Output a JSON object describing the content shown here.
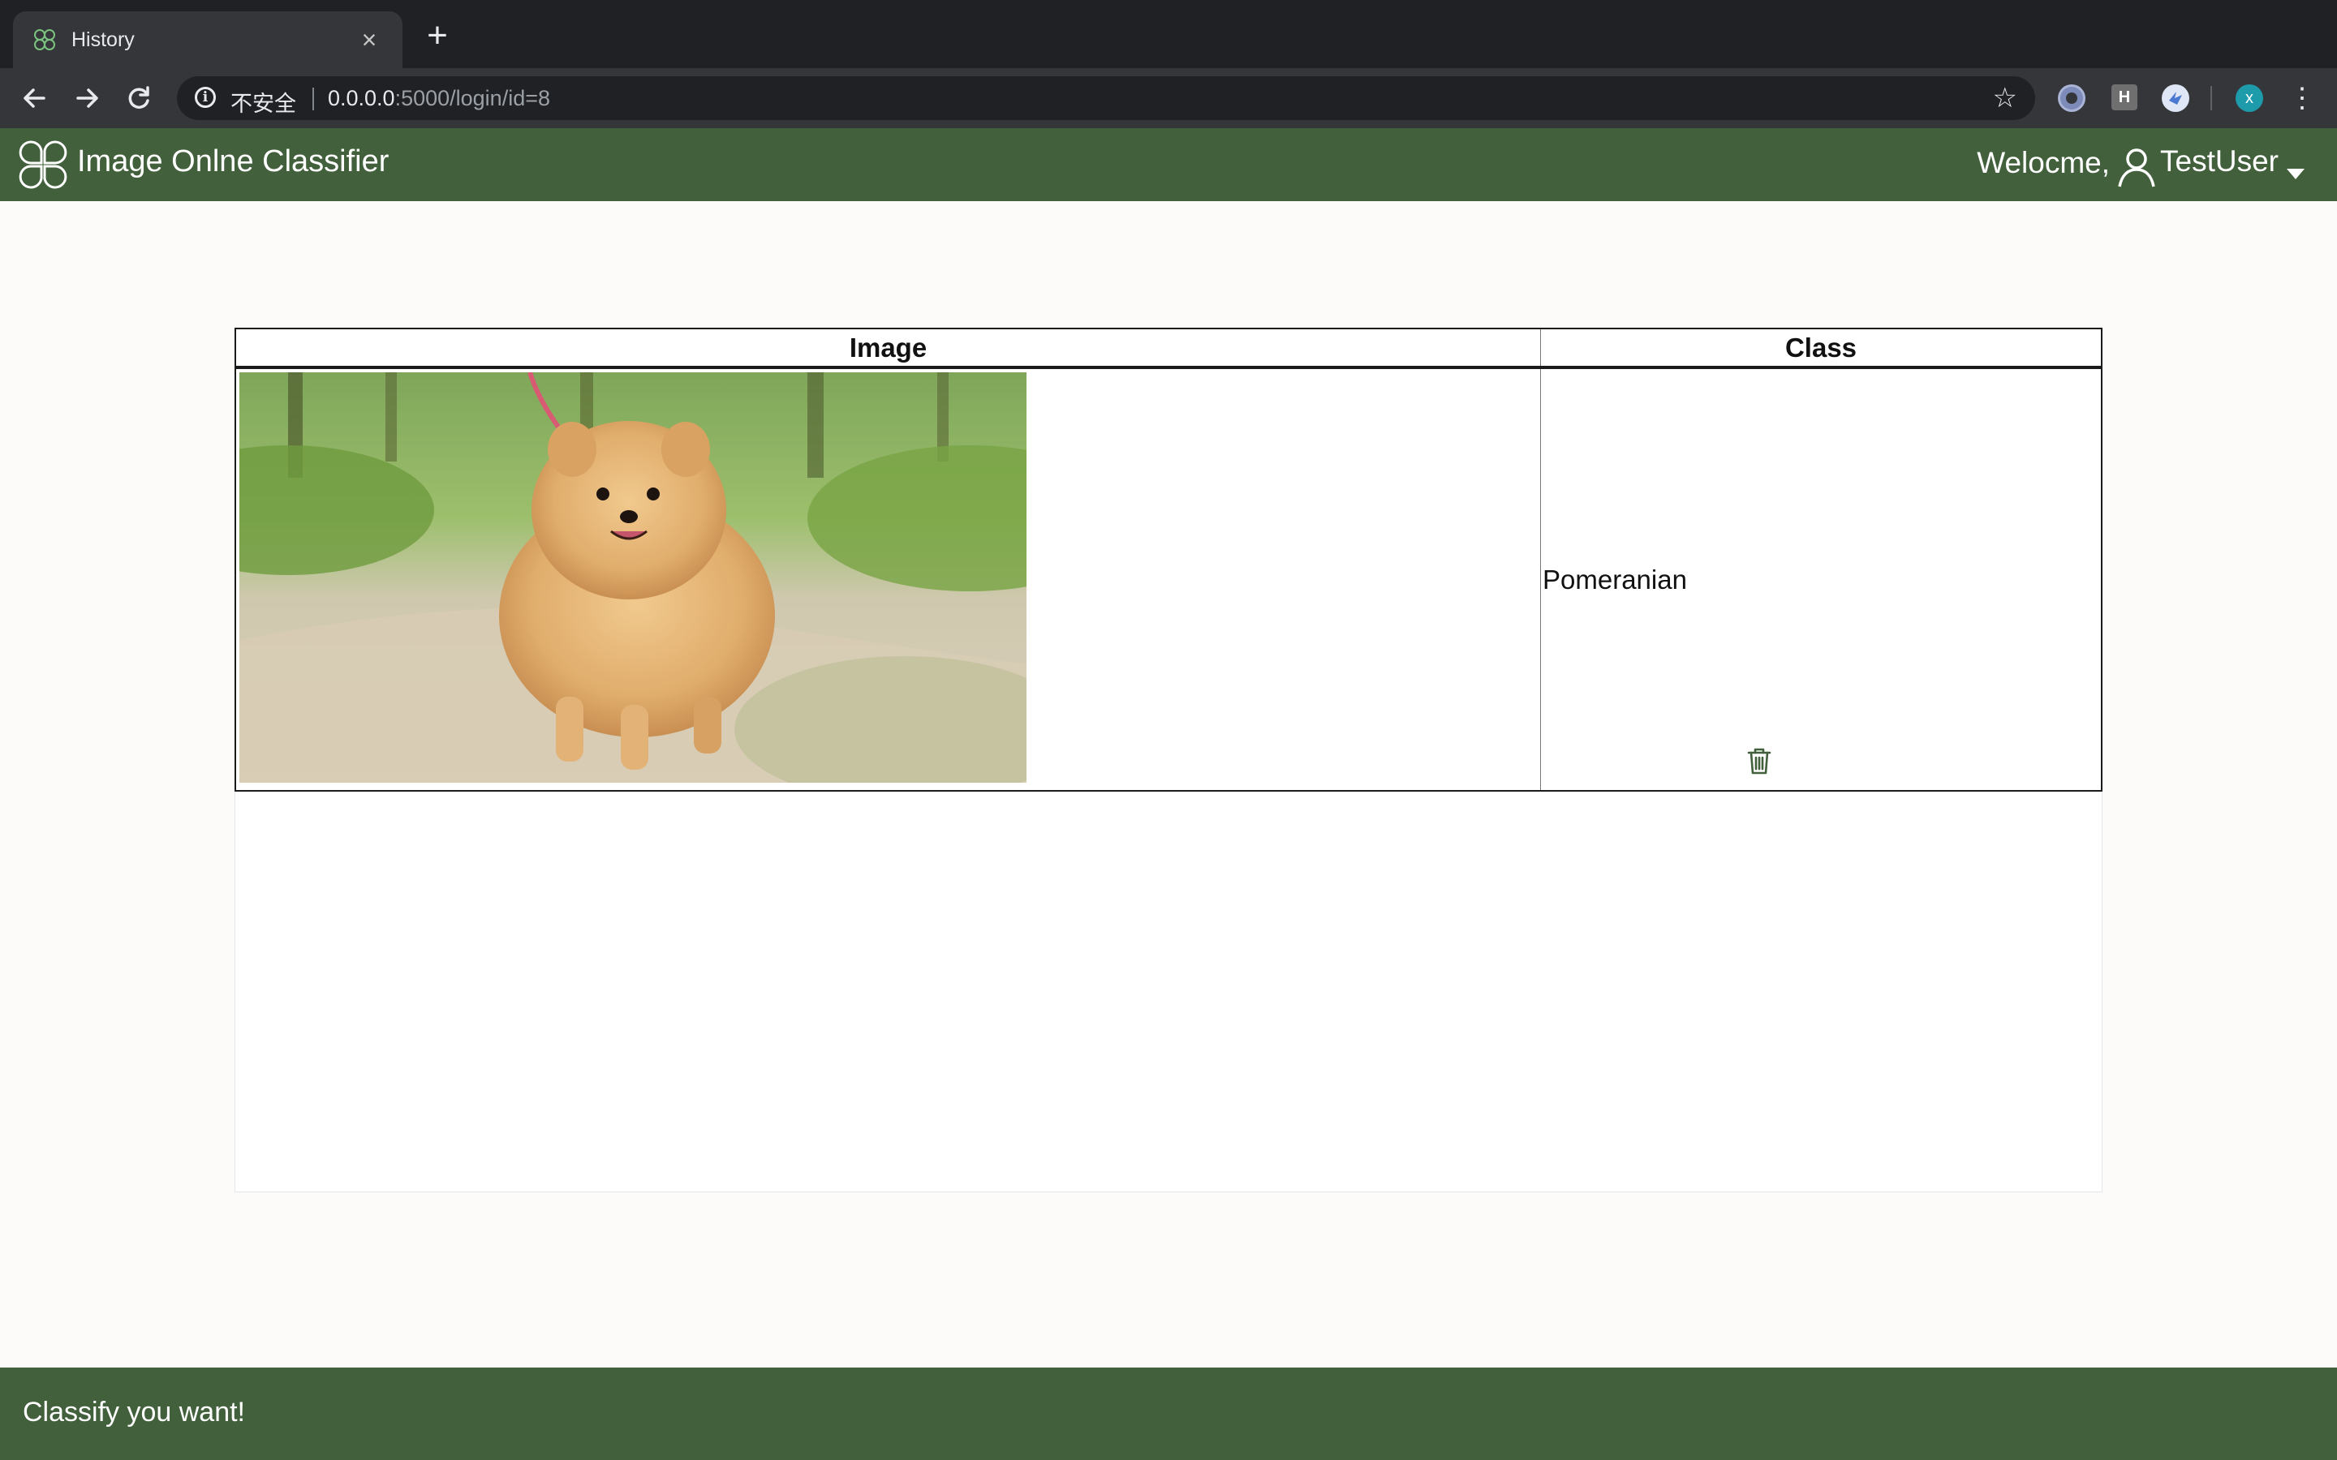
{
  "browser": {
    "tab_title": "History",
    "tab_close": "×",
    "new_tab": "+",
    "security_label": "不安全",
    "url_host": "0.0.0.0",
    "url_rest": ":5000/login/id=8",
    "extensions": [
      {
        "label": "",
        "bg": "#aab4d6"
      },
      {
        "label": "H",
        "bg": "#6f6f6f"
      },
      {
        "label": "",
        "bg": "#dfe6f5"
      },
      {
        "label": "x",
        "bg": "#1e9bab"
      }
    ]
  },
  "header": {
    "brand": "Image Onlne Classifier",
    "welcome": "Welocme,",
    "username": "TestUser"
  },
  "table": {
    "headers": [
      "Image",
      "Class"
    ],
    "rows": [
      {
        "class": "Pomeranian",
        "image_alt": "pomeranian-photo"
      }
    ]
  },
  "footer": {
    "text": "Classify you want!"
  },
  "colors": {
    "header_bg": "#41603b",
    "footer_bg": "#41603b",
    "page_bg": "#fcfbf9",
    "accent_icon": "#41603b"
  }
}
